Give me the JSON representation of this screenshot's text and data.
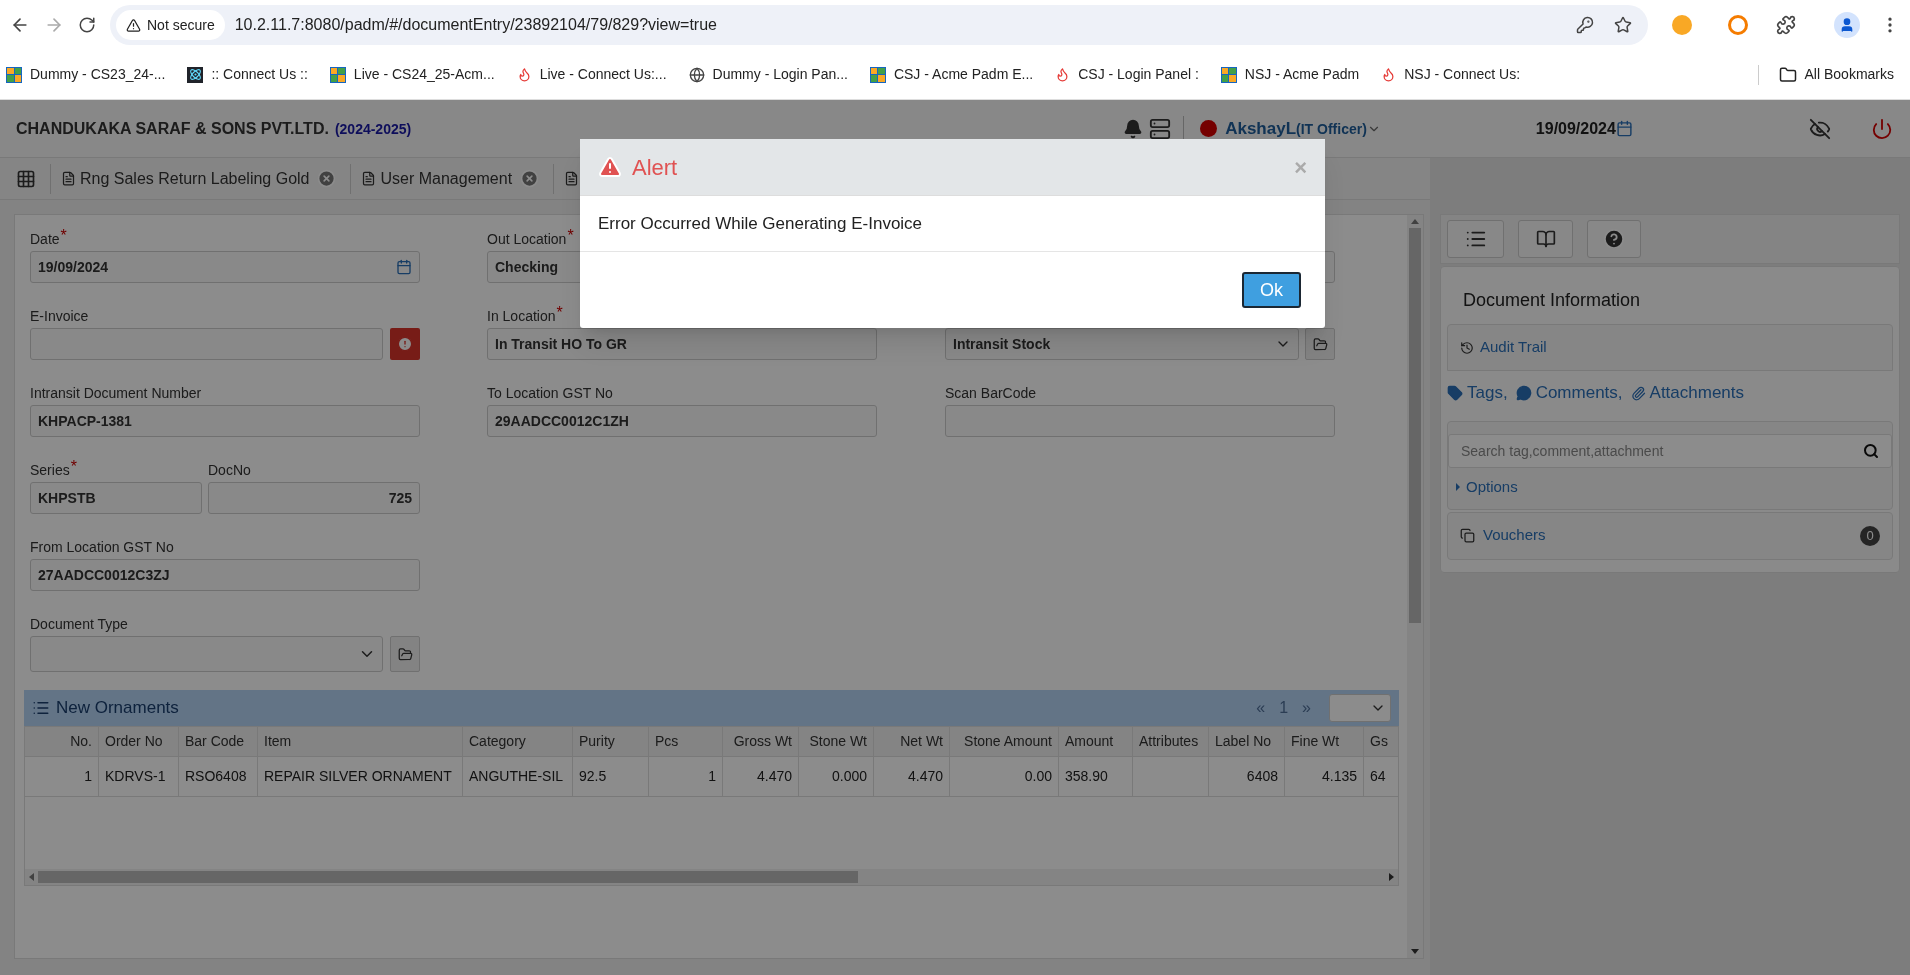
{
  "browser": {
    "security": "Not secure",
    "url": "10.2.11.7:8080/padm/#/documentEntry/23892104/79/829?view=true",
    "bookmarks": [
      {
        "label": "Dummy  - CS23_24-...",
        "kind": "grid"
      },
      {
        "label": ":: Connect Us ::",
        "kind": "atom"
      },
      {
        "label": "Live - CS24_25-Acm...",
        "kind": "grid"
      },
      {
        "label": "Live - Connect Us:...",
        "kind": "flame"
      },
      {
        "label": "Dummy - Login Pan...",
        "kind": "globe"
      },
      {
        "label": "CSJ - Acme Padm E...",
        "kind": "grid"
      },
      {
        "label": "CSJ - Login Panel :",
        "kind": "flame"
      },
      {
        "label": "NSJ - Acme Padm",
        "kind": "grid"
      },
      {
        "label": "NSJ - Connect Us:",
        "kind": "flame"
      }
    ],
    "all_bookmarks": "All Bookmarks"
  },
  "header": {
    "company": "CHANDUKAKA SARAF & SONS PVT.LTD.",
    "year": "(2024-2025)",
    "user": "AkshayL",
    "role": "(IT Officer)",
    "date": "19/09/2024"
  },
  "tabs": [
    {
      "label": "Rng Sales Return Labeling Gold"
    },
    {
      "label": "User Management"
    }
  ],
  "form": {
    "date": {
      "label": "Date",
      "mark": "*",
      "value": "19/09/2024"
    },
    "einvoice": {
      "label": "E-Invoice"
    },
    "intransit": {
      "label": "Intransit Document Number",
      "value": "KHPACP-1381"
    },
    "series": {
      "label": "Series",
      "mark": "*",
      "value": "KHPSTB"
    },
    "docno": {
      "label": "DocNo",
      "value": "725"
    },
    "from_gst": {
      "label": "From Location GST No",
      "value": "27AADCC0012C3ZJ"
    },
    "doc_type": {
      "label": "Document Type"
    },
    "out_location": {
      "label": "Out Location",
      "mark": "*",
      "value": "Checking"
    },
    "in_location": {
      "label": "In Location",
      "mark": "*",
      "value": "In Transit HO To GR"
    },
    "to_gst": {
      "label": "To Location GST No",
      "value": "29AADCC0012C1ZH"
    },
    "stock": {
      "value": "Intransit Stock"
    },
    "scan": {
      "label": "Scan BarCode"
    }
  },
  "table": {
    "title": "New Ornaments",
    "pager": [
      "«",
      "1",
      "»"
    ],
    "columns": [
      "No.",
      "Order No",
      "Bar Code",
      "Item",
      "Category",
      "Purity",
      "Pcs",
      "Gross Wt",
      "Stone Wt",
      "Net Wt",
      "Stone Amount",
      "Amount",
      "Attributes",
      "Label No",
      "Fine Wt",
      "Gs"
    ],
    "rows": [
      [
        "1",
        "KDRVS-1",
        "RSO6408",
        "REPAIR SILVER ORNAMENT",
        "ANGUTHE-SIL",
        "92.5",
        "1",
        "4.470",
        "0.000",
        "4.470",
        "0.00",
        "358.90",
        "",
        "6408",
        "4.135",
        "64"
      ]
    ]
  },
  "side": {
    "title": "Document Information",
    "audit": "Audit Trail",
    "tags": "Tags,",
    "comments": "Comments,",
    "attachments": "Attachments",
    "search_placeholder": "Search tag,comment,attachment",
    "options": "Options",
    "vouchers": "Vouchers",
    "vouchers_count": "0"
  },
  "alert": {
    "title": "Alert",
    "close": "×",
    "message": "Error Occurred While Generating E-Invoice",
    "button": "Ok"
  }
}
